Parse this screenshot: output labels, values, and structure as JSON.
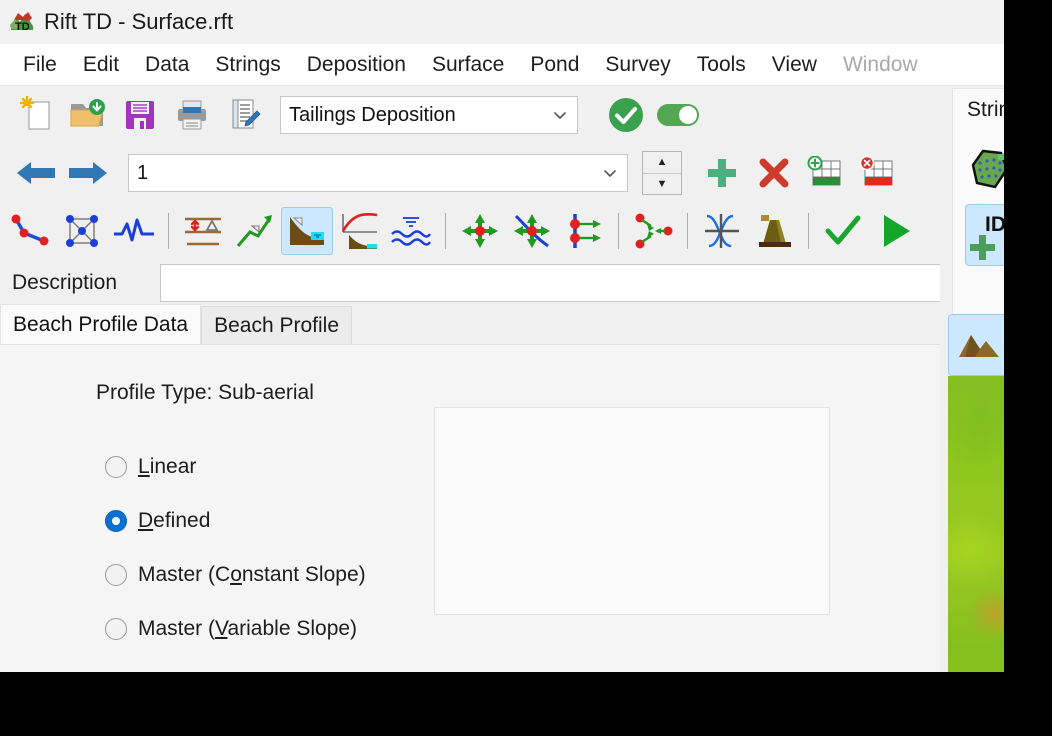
{
  "window": {
    "title": "Rift TD - Surface.rft",
    "app_icon": "terrain-td-icon"
  },
  "menubar": {
    "items": [
      {
        "label": "File",
        "disabled": false
      },
      {
        "label": "Edit",
        "disabled": false
      },
      {
        "label": "Data",
        "disabled": false
      },
      {
        "label": "Strings",
        "disabled": false
      },
      {
        "label": "Deposition",
        "disabled": false
      },
      {
        "label": "Surface",
        "disabled": false
      },
      {
        "label": "Pond",
        "disabled": false
      },
      {
        "label": "Survey",
        "disabled": false
      },
      {
        "label": "Tools",
        "disabled": false
      },
      {
        "label": "View",
        "disabled": false
      },
      {
        "label": "Window",
        "disabled": true
      }
    ]
  },
  "toolbar_file": {
    "buttons": [
      {
        "name": "new-file-icon"
      },
      {
        "name": "open-folder-icon"
      },
      {
        "name": "save-icon"
      },
      {
        "name": "print-icon"
      },
      {
        "name": "edit-notes-icon"
      }
    ],
    "deposition_combo": {
      "value": "Tailings Deposition",
      "options": [
        "Tailings Deposition"
      ]
    },
    "accept_button": "accept-check-icon",
    "toggle": {
      "name": "enable-toggle",
      "state": "on",
      "color": "#53a653"
    }
  },
  "toolbar_nav": {
    "back_button": "back-arrow-icon",
    "forward_button": "forward-arrow-icon",
    "index_combo": {
      "value": "1",
      "options": [
        "1"
      ]
    },
    "spinner": {
      "up": "spinner-up-icon",
      "down": "spinner-down-icon"
    },
    "add_button": "add-plus-icon",
    "delete_button": "delete-x-icon",
    "add_row_button": "add-table-row-icon",
    "delete_row_button": "delete-table-row-icon"
  },
  "toolbar_tools": {
    "buttons": [
      {
        "name": "polyline-icon",
        "selected": false
      },
      {
        "name": "mesh-nodes-icon",
        "selected": false
      },
      {
        "name": "waveform-icon",
        "selected": false
      },
      {
        "name": "separator-1",
        "separator": true
      },
      {
        "name": "elevation-delta-icon",
        "selected": false
      },
      {
        "name": "slope-arrow-icon",
        "selected": false
      },
      {
        "name": "beach-profile-icon",
        "selected": true
      },
      {
        "name": "profile-curve-icon",
        "selected": false
      },
      {
        "name": "water-waves-icon",
        "selected": false
      },
      {
        "name": "separator-2",
        "separator": true
      },
      {
        "name": "move-point-icon",
        "selected": false
      },
      {
        "name": "move-point-on-line-icon",
        "selected": false
      },
      {
        "name": "offset-points-icon",
        "selected": false
      },
      {
        "name": "separator-3",
        "separator": true
      },
      {
        "name": "split-string-icon",
        "selected": false
      },
      {
        "name": "separator-4",
        "separator": true
      },
      {
        "name": "intersect-lines-icon",
        "selected": false
      },
      {
        "name": "embankment-icon",
        "selected": false
      },
      {
        "name": "separator-5",
        "separator": true
      },
      {
        "name": "apply-check-icon",
        "selected": false
      },
      {
        "name": "run-play-icon",
        "selected": false
      }
    ]
  },
  "description": {
    "label": "Description",
    "value": "",
    "placeholder": ""
  },
  "tabs": [
    {
      "label": "Beach Profile Data",
      "active": true
    },
    {
      "label": "Beach Profile",
      "active": false
    }
  ],
  "content": {
    "profile_type_label": "Profile Type: Sub-aerial",
    "radios": [
      {
        "label_pre": "",
        "label_key": "L",
        "label_post": "inear",
        "selected": false,
        "name": "radio-linear"
      },
      {
        "label_pre": "",
        "label_key": "D",
        "label_post": "efined",
        "selected": true,
        "name": "radio-defined"
      },
      {
        "label_pre": "Master (C",
        "label_key": "o",
        "label_post": "nstant Slope)",
        "selected": false,
        "name": "radio-master-constant-slope"
      },
      {
        "label_pre": "Master (",
        "label_key": "V",
        "label_post": "ariable Slope)",
        "selected": false,
        "name": "radio-master-variable-slope"
      }
    ],
    "preview_panel": {
      "name": "profile-preview-panel",
      "content": ""
    }
  },
  "right_dock": {
    "tab_label": "String",
    "buttons": [
      {
        "name": "add-polygon-icon",
        "selected": false
      },
      {
        "name": "add-id-icon",
        "selected": true,
        "label": "ID"
      },
      {
        "name": "terrain-surface-icon",
        "selected": true
      }
    ]
  },
  "colors": {
    "accent_blue": "#0b70d1",
    "toolbar_bg": "#f0f0f0",
    "content_bg": "#fafafa",
    "selection_blue": "#cce8ff",
    "green": "#53a653",
    "red": "#cc3b2b"
  }
}
